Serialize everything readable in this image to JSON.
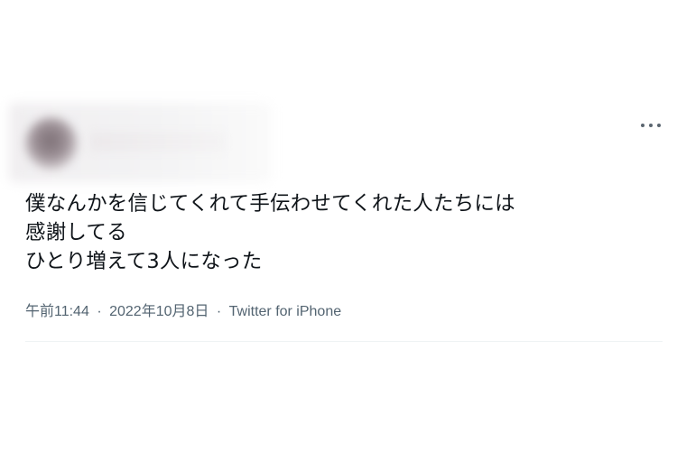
{
  "tweet": {
    "text_lines": [
      "僕なんかを信じてくれて手伝わせてくれた人たちには",
      "感謝してる",
      "ひとり増えて3人になった"
    ],
    "time": "午前11:44",
    "separator": "·",
    "date": "2022年10月8日",
    "source": "Twitter for iPhone"
  },
  "icons": {
    "more": "more-horizontal-icon",
    "avatar": "blurred-avatar"
  },
  "colors": {
    "text": "#0f1419",
    "meta": "#536471",
    "divider": "#eff3f4"
  }
}
